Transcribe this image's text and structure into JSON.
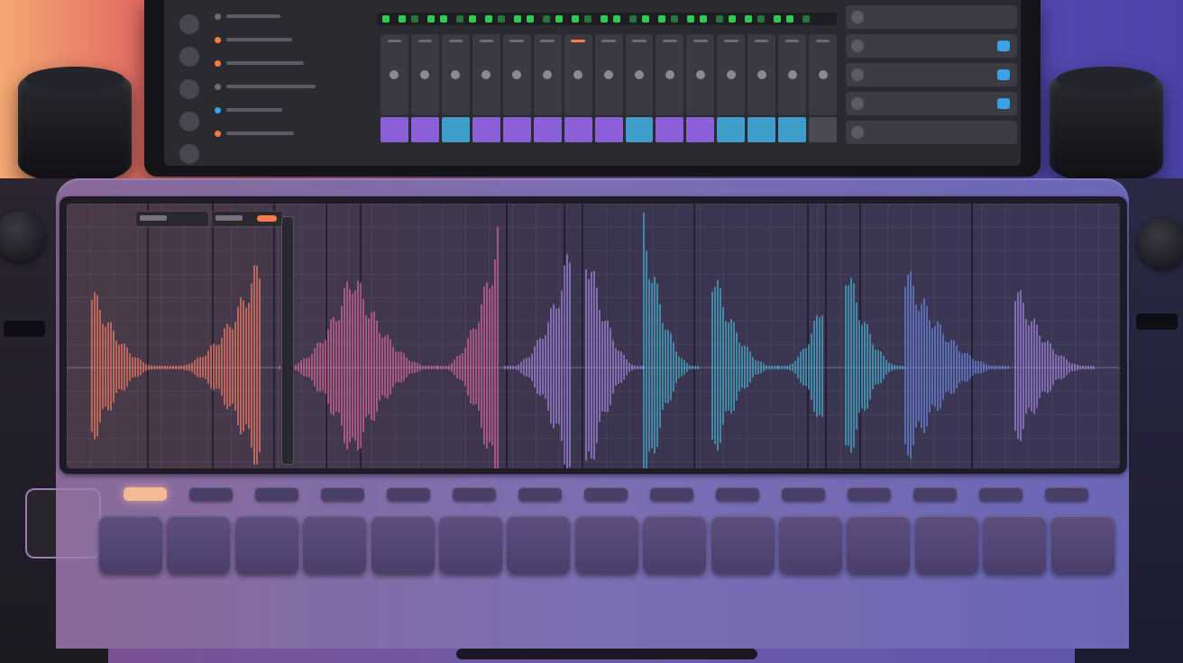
{
  "monitor": {
    "meter_color": "#2ecc51",
    "clip_colors": [
      "#8b5fd6",
      "#8b5fd6",
      "#3f9dc9",
      "#8b5fd6",
      "#8b5fd6",
      "#8b5fd6",
      "#8b5fd6",
      "#8b5fd6",
      "#3f9dc9",
      "#8b5fd6",
      "#8b5fd6",
      "#3f9dc9",
      "#3f9dc9",
      "#3f9dc9",
      "#4a4a52"
    ],
    "channel_count": 15,
    "hot_channel_index": 6,
    "right_panel_rows": 5,
    "left_list_rows": 6,
    "left_icons": [
      "track-icon",
      "folder-icon",
      "clock-icon",
      "mixer-icon",
      "file-icon"
    ]
  },
  "touchscreen": {
    "grid": true,
    "track_headers": [
      {
        "name": "track-header-1"
      },
      {
        "name": "track-header-2"
      }
    ],
    "accent_colors": {
      "coral": "#ff7f64",
      "pink": "#e06aa0",
      "violet": "#a889e8",
      "cyan": "#44b9d8",
      "blue": "#6e8be8"
    }
  },
  "controller": {
    "step_button_count": 15,
    "lit_step_index": 0,
    "lit_color": "#f4b995",
    "pad_count": 15
  }
}
